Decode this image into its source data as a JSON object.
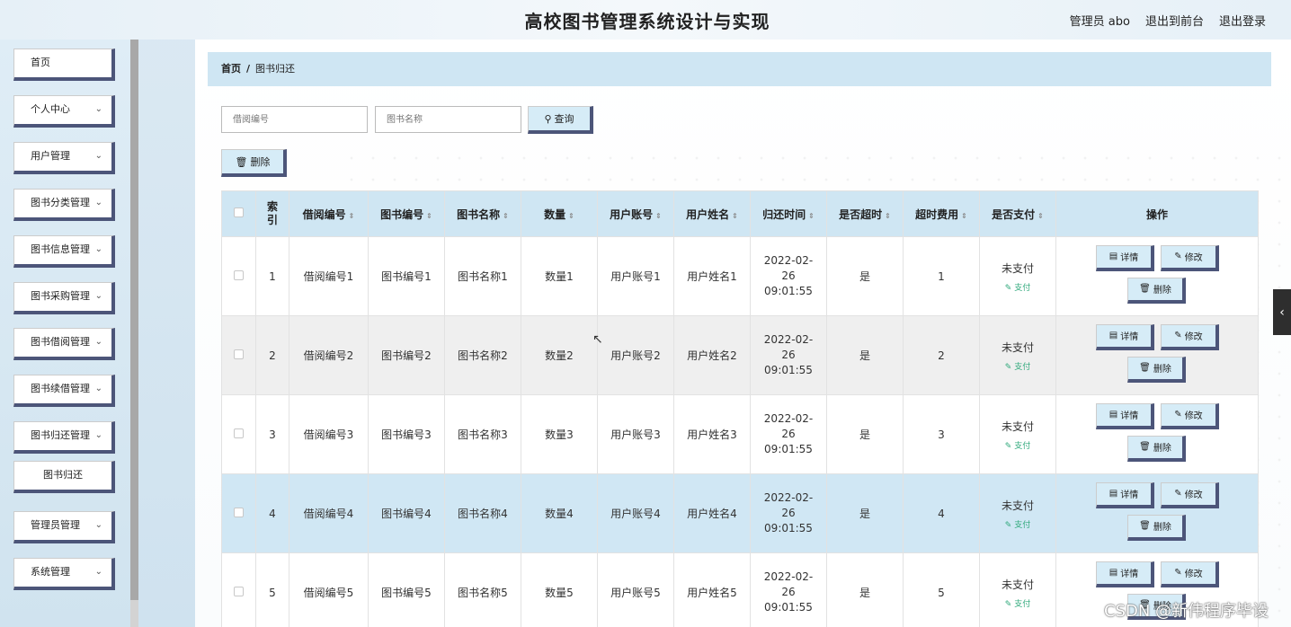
{
  "header": {
    "title": "高校图书管理系统设计与实现",
    "links": [
      "管理员 abo",
      "退出到前台",
      "退出登录"
    ]
  },
  "sidebar": {
    "items": [
      {
        "label": "首页",
        "expandable": false
      },
      {
        "label": "个人中心",
        "expandable": true
      },
      {
        "label": "用户管理",
        "expandable": true
      },
      {
        "label": "图书分类管理",
        "expandable": true
      },
      {
        "label": "图书信息管理",
        "expandable": true
      },
      {
        "label": "图书采购管理",
        "expandable": true
      },
      {
        "label": "图书借阅管理",
        "expandable": true
      },
      {
        "label": "图书续借管理",
        "expandable": true
      },
      {
        "label": "图书归还管理",
        "expandable": true
      },
      {
        "label": "图书归还",
        "expandable": false,
        "sub": true
      },
      {
        "label": "管理员管理",
        "expandable": true
      },
      {
        "label": "系统管理",
        "expandable": true
      }
    ]
  },
  "breadcrumb": {
    "home": "首页",
    "current": "图书归还"
  },
  "search": {
    "field1_placeholder": "借阅编号",
    "field2_placeholder": "图书名称",
    "query_label": "查询",
    "delete_label": "删除"
  },
  "table": {
    "columns": [
      "索引",
      "借阅编号",
      "图书编号",
      "图书名称",
      "数量",
      "用户账号",
      "用户姓名",
      "归还时间",
      "是否超时",
      "超时费用",
      "是否支付",
      "操作"
    ],
    "rows": [
      {
        "index": "1",
        "borrow_no": "借阅编号1",
        "book_no": "图书编号1",
        "book_name": "图书名称1",
        "qty": "数量1",
        "account": "用户账号1",
        "user_name": "用户姓名1",
        "return_time": "2022-02-26 09:01:55",
        "overdue": "是",
        "fee": "1",
        "paid": "未支付",
        "pay_action": "支付"
      },
      {
        "index": "2",
        "borrow_no": "借阅编号2",
        "book_no": "图书编号2",
        "book_name": "图书名称2",
        "qty": "数量2",
        "account": "用户账号2",
        "user_name": "用户姓名2",
        "return_time": "2022-02-26 09:01:55",
        "overdue": "是",
        "fee": "2",
        "paid": "未支付",
        "pay_action": "支付"
      },
      {
        "index": "3",
        "borrow_no": "借阅编号3",
        "book_no": "图书编号3",
        "book_name": "图书名称3",
        "qty": "数量3",
        "account": "用户账号3",
        "user_name": "用户姓名3",
        "return_time": "2022-02-26 09:01:55",
        "overdue": "是",
        "fee": "3",
        "paid": "未支付",
        "pay_action": "支付"
      },
      {
        "index": "4",
        "borrow_no": "借阅编号4",
        "book_no": "图书编号4",
        "book_name": "图书名称4",
        "qty": "数量4",
        "account": "用户账号4",
        "user_name": "用户姓名4",
        "return_time": "2022-02-26 09:01:55",
        "overdue": "是",
        "fee": "4",
        "paid": "未支付",
        "pay_action": "支付"
      },
      {
        "index": "5",
        "borrow_no": "借阅编号5",
        "book_no": "图书编号5",
        "book_name": "图书名称5",
        "qty": "数量5",
        "account": "用户账号5",
        "user_name": "用户姓名5",
        "return_time": "2022-02-26 09:01:55",
        "overdue": "是",
        "fee": "5",
        "paid": "未支付",
        "pay_action": "支付"
      }
    ],
    "row_actions": {
      "detail": "详情",
      "edit": "修改",
      "delete": "删除"
    }
  },
  "watermark": "CSDN @新伟程序毕设",
  "colors": {
    "accent": "#4c5579",
    "header_bg": "#cfe6f3",
    "pay_green": "#2ea87a",
    "highlight_row": "#d0e7f4"
  }
}
